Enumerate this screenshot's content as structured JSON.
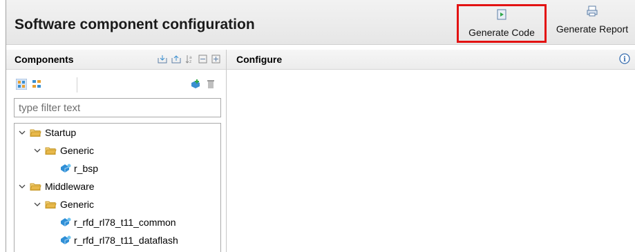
{
  "header": {
    "title": "Software component configuration",
    "generate_code_label": "Generate Code",
    "generate_report_label": "Generate Report",
    "highlight_color": "#e31212"
  },
  "components": {
    "title": "Components",
    "filter_placeholder": "type filter text",
    "tree": [
      {
        "label": "Startup",
        "kind": "folder"
      },
      {
        "label": "Generic",
        "kind": "folder"
      },
      {
        "label": "r_bsp",
        "kind": "component"
      },
      {
        "label": "Middleware",
        "kind": "folder"
      },
      {
        "label": "Generic",
        "kind": "folder"
      },
      {
        "label": "r_rfd_rl78_t11_common",
        "kind": "component"
      },
      {
        "label": "r_rfd_rl78_t11_dataflash",
        "kind": "component"
      }
    ]
  },
  "configure": {
    "title": "Configure"
  },
  "colors": {
    "folder": "#e8b84a",
    "component": "#2f8fd6",
    "highlight": "#e31212"
  }
}
